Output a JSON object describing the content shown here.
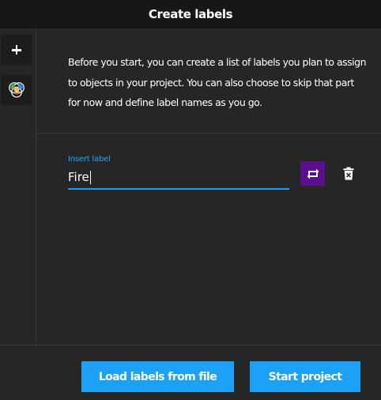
{
  "window": {
    "title": "Create labels"
  },
  "sidebar": {
    "items": [
      {
        "name": "add",
        "icon": "plus-icon"
      },
      {
        "name": "labels",
        "icon": "color-circles-icon"
      }
    ]
  },
  "description": {
    "text": "Before you start, you can create a list of labels you plan to assign to objects in your project. You can also choose to skip that part for now and define label names as you go."
  },
  "labels": [
    {
      "caption": "Insert label",
      "value": "Fire",
      "color": "#5b0f8f",
      "color_icon": "change-color-icon",
      "delete_icon": "delete-icon"
    }
  ],
  "footer": {
    "load_label": "Load labels from file",
    "start_label": "Start project"
  },
  "colors": {
    "accent": "#1ba1f5",
    "label_color": "#5b0f8f",
    "titlebar": "#171717",
    "background": "#262626"
  }
}
